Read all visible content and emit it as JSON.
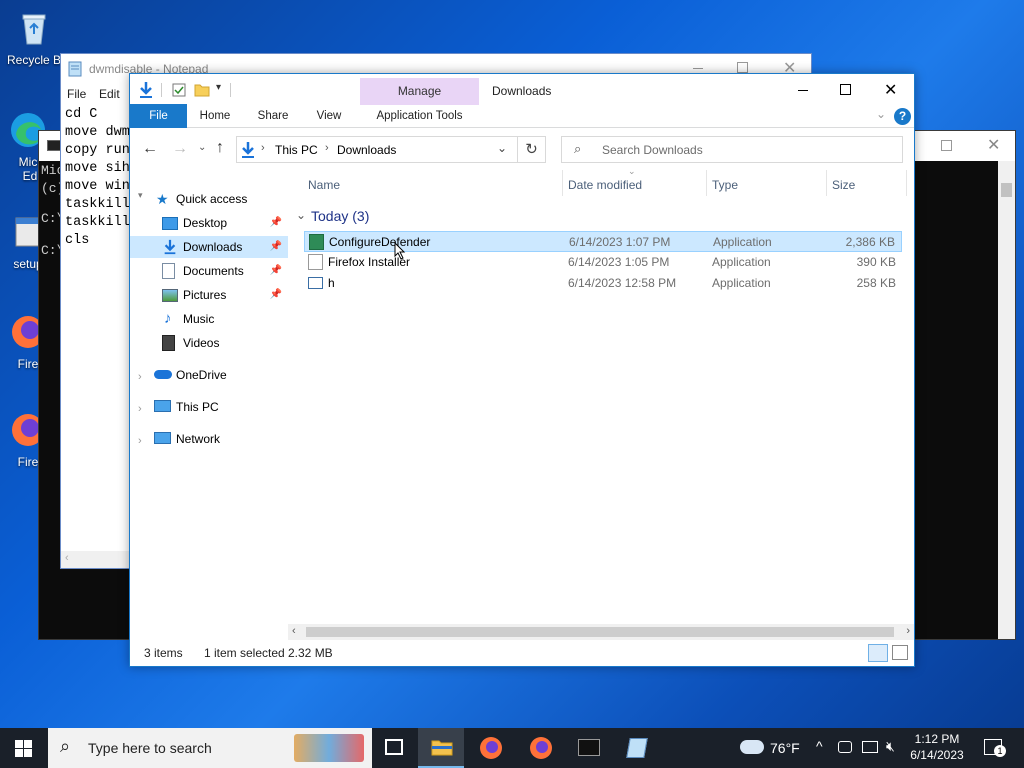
{
  "desktop": {
    "icons": [
      {
        "label": "Recycle Bin",
        "shown": "Recycle B"
      },
      {
        "label": "Microsoft Edge",
        "shown": "Micr Ed"
      },
      {
        "label": "setup",
        "shown": "setup"
      },
      {
        "label": "Firefox",
        "shown": "Fire"
      },
      {
        "label": "Firefox",
        "shown": "Fire"
      }
    ]
  },
  "console": {
    "lines": [
      "Mic",
      "(c)",
      "",
      "C:\\",
      "",
      "C:\\"
    ]
  },
  "notepad": {
    "title": "dwmdisable - Notepad",
    "menu": [
      "File",
      "Edit"
    ],
    "text": "cd C\nmove dwm\ncopy run\nmove sih\nmove win\ntaskkill\ntaskkill\ncls"
  },
  "explorer": {
    "context_title": "Downloads",
    "manage_label": "Manage",
    "tabs": [
      "File",
      "Home",
      "Share",
      "View",
      "Application Tools"
    ],
    "breadcrumb": [
      "This PC",
      "Downloads"
    ],
    "search_placeholder": "Search Downloads",
    "nav": {
      "quick_access": "Quick access",
      "items": [
        {
          "label": "Desktop",
          "pinned": true
        },
        {
          "label": "Downloads",
          "pinned": true,
          "selected": true
        },
        {
          "label": "Documents",
          "pinned": true
        },
        {
          "label": "Pictures",
          "pinned": true
        },
        {
          "label": "Music",
          "pinned": false
        },
        {
          "label": "Videos",
          "pinned": false
        }
      ],
      "onedrive": "OneDrive",
      "this_pc": "This PC",
      "network": "Network"
    },
    "columns": [
      "Name",
      "Date modified",
      "Type",
      "Size"
    ],
    "group_label": "Today (3)",
    "files": [
      {
        "name": "ConfigureDefender",
        "date": "6/14/2023 1:07 PM",
        "type": "Application",
        "size": "2,386 KB",
        "selected": true
      },
      {
        "name": "Firefox Installer",
        "date": "6/14/2023 1:05 PM",
        "type": "Application",
        "size": "390 KB",
        "selected": false
      },
      {
        "name": "h",
        "date": "6/14/2023 12:58 PM",
        "type": "Application",
        "size": "258 KB",
        "selected": false
      }
    ],
    "status": {
      "count": "3 items",
      "selection": "1 item selected",
      "size": "2.32 MB"
    }
  },
  "taskbar": {
    "search_placeholder": "Type here to search",
    "weather": "76°F",
    "time": "1:12 PM",
    "date": "6/14/2023",
    "notification_count": "1"
  },
  "colors": {
    "accent": "#1979ca",
    "selection": "#cce8ff",
    "manage": "#e9d5f6",
    "taskbar": "#1a2029"
  }
}
